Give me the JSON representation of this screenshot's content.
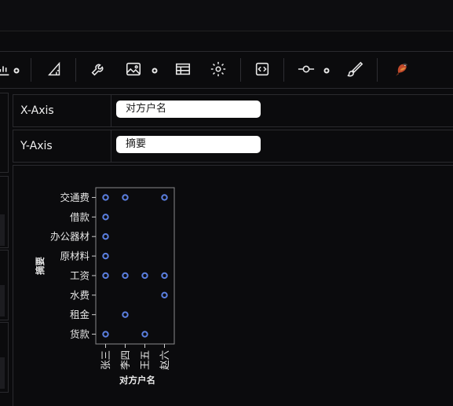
{
  "toolbar": {
    "icons": [
      "chart-icon",
      "settings-small-icon",
      "ruler-triangle-icon",
      "wrench-icon",
      "image-icon",
      "table-icon",
      "gear-icon",
      "code-icon",
      "commit-icon",
      "brush-icon",
      "bird-logo-icon"
    ]
  },
  "fields": {
    "x_axis": {
      "label": "X-Axis",
      "value": "对方户名"
    },
    "y_axis": {
      "label": "Y-Axis",
      "value": "摘要"
    }
  },
  "chart_data": {
    "type": "scatter",
    "xlabel": "对方户名",
    "ylabel": "摘要",
    "x_categories": [
      "张三",
      "李四",
      "王五",
      "赵六"
    ],
    "y_categories": [
      "交通费",
      "借款",
      "办公器材",
      "原材料",
      "工资",
      "水费",
      "租金",
      "货款"
    ],
    "points": [
      {
        "x": "张三",
        "y": "交通费"
      },
      {
        "x": "李四",
        "y": "交通费"
      },
      {
        "x": "赵六",
        "y": "交通费"
      },
      {
        "x": "张三",
        "y": "借款"
      },
      {
        "x": "张三",
        "y": "办公器材"
      },
      {
        "x": "张三",
        "y": "原材料"
      },
      {
        "x": "张三",
        "y": "工资"
      },
      {
        "x": "李四",
        "y": "工资"
      },
      {
        "x": "王五",
        "y": "工资"
      },
      {
        "x": "赵六",
        "y": "工资"
      },
      {
        "x": "赵六",
        "y": "水费"
      },
      {
        "x": "李四",
        "y": "租金"
      },
      {
        "x": "张三",
        "y": "货款"
      },
      {
        "x": "王五",
        "y": "货款"
      }
    ],
    "marker_color": "#5b7fe0",
    "grid": false
  }
}
